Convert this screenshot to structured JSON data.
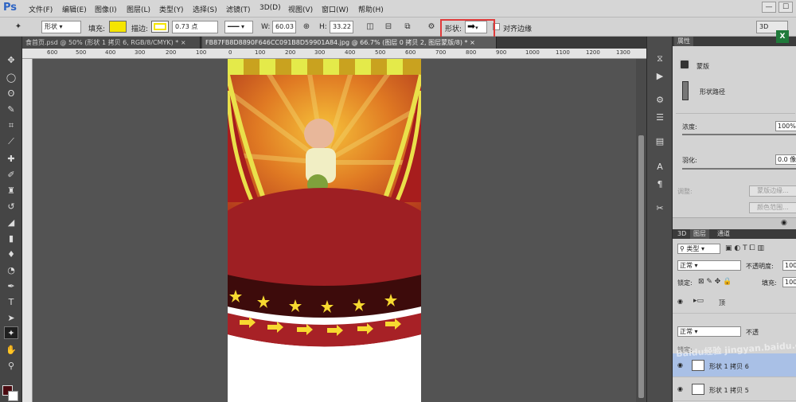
{
  "app": {
    "logo": "Ps"
  },
  "menubar": {
    "items": [
      "文件(F)",
      "编辑(E)",
      "图像(I)",
      "图层(L)",
      "类型(Y)",
      "选择(S)",
      "滤镜(T)",
      "3D(D)",
      "视图(V)",
      "窗口(W)",
      "帮助(H)"
    ],
    "window_buttons": [
      "—",
      "☐"
    ]
  },
  "options": {
    "mode_value": "形状",
    "fill_label": "填充:",
    "fill_color": "#f5e500",
    "stroke_label": "描边:",
    "stroke_color": "#f5e500",
    "stroke_width": "0.73 点",
    "w_label": "W:",
    "w_value": "60.03",
    "h_label": "H:",
    "h_value": "33.22",
    "shape_label": "形状:",
    "align_edges_label": "对齐边缘",
    "workspace_button": "3D"
  },
  "tabs": [
    {
      "label": "食首页.psd @ 50% (形状 1 拷贝 6, RGB/8/CMYK) *",
      "close": "×",
      "active": false
    },
    {
      "label": "FB87FB8D8890F646CC091B8D59901A84.jpg @ 66.7% (图层 0 拷贝 2, 图层蒙版/8) *",
      "close": "×",
      "active": true
    }
  ],
  "ruler": {
    "ticks": [
      "600",
      "500",
      "400",
      "300",
      "200",
      "100",
      "0",
      "100",
      "200",
      "300",
      "400",
      "500",
      "600",
      "700",
      "800",
      "900",
      "1000",
      "1100",
      "1200",
      "1300"
    ]
  },
  "toolbox": {
    "tools": [
      "move-tool",
      "marquee-tool",
      "lasso-tool",
      "quick-select-tool",
      "crop-tool",
      "eyedropper-tool",
      "healing-tool",
      "brush-tool",
      "clone-stamp-tool",
      "history-brush-tool",
      "eraser-tool",
      "gradient-tool",
      "blur-tool",
      "dodge-tool",
      "pen-tool",
      "type-tool",
      "path-select-tool",
      "custom-shape-tool",
      "hand-tool",
      "zoom-tool"
    ],
    "fg_color": "#4a0a10",
    "bg_color": "#ffffff"
  },
  "properties": {
    "tab": "属性",
    "mask_title": "蒙版",
    "shape_path_label": "形状路径",
    "density_label": "浓度:",
    "density_value": "100%",
    "feather_label": "羽化:",
    "feather_value": "0.0 像",
    "adjust_label": "调整:",
    "mask_edge_button": "蒙版边缘...",
    "color_range_button": "颜色范围..."
  },
  "layers": {
    "tabs": [
      "3D",
      "图层",
      "通道"
    ],
    "filter_label": "类型",
    "blend_mode": "正常",
    "opacity_label": "不透明度:",
    "opacity_value": "100",
    "lock_label": "锁定:",
    "fill_label": "填充:",
    "fill_value": "100",
    "group_name": "顶",
    "blend_mode_2": "正常",
    "opacity_label_2": "不透",
    "lock_label_2": "锁定:",
    "items": [
      {
        "name": "形状 1 拷贝 6",
        "selected": true
      },
      {
        "name": "形状 1 拷贝 5",
        "selected": false
      }
    ]
  },
  "watermark": "Baidu经验 jingyan.baidu.com",
  "accent_colors": {
    "highlight_box": "#e03a3a",
    "selected_layer": "#a9c0e6"
  }
}
